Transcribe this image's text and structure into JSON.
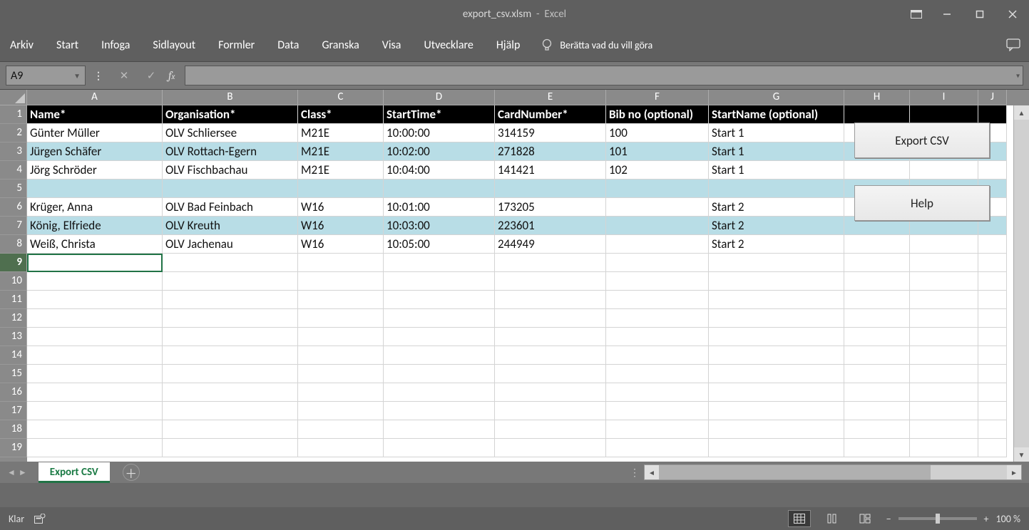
{
  "title": {
    "filename": "export_csv.xlsm",
    "app": "Excel"
  },
  "ribbon": {
    "tabs": [
      "Arkiv",
      "Start",
      "Infoga",
      "Sidlayout",
      "Formler",
      "Data",
      "Granska",
      "Visa",
      "Utvecklare",
      "Hjälp"
    ],
    "tell_me": "Berätta vad du vill göra"
  },
  "formula_bar": {
    "name_box": "A9",
    "formula": ""
  },
  "columns": [
    {
      "letter": "A",
      "width": 190
    },
    {
      "letter": "B",
      "width": 190
    },
    {
      "letter": "C",
      "width": 120
    },
    {
      "letter": "D",
      "width": 156
    },
    {
      "letter": "E",
      "width": 156
    },
    {
      "letter": "F",
      "width": 144
    },
    {
      "letter": "G",
      "width": 190
    },
    {
      "letter": "H",
      "width": 92
    },
    {
      "letter": "I",
      "width": 96
    },
    {
      "letter": "J",
      "width": 40
    }
  ],
  "headers": [
    "Name*",
    "Organisation*",
    "Class*",
    "StartTime*",
    "CardNumber*",
    "Bib no (optional)",
    "StartName (optional)"
  ],
  "rows": [
    {
      "alt": false,
      "cells": [
        "Günter Müller",
        "OLV Schliersee",
        "M21E",
        "10:00:00",
        "314159",
        "100",
        "Start 1"
      ]
    },
    {
      "alt": true,
      "cells": [
        "Jürgen Schäfer",
        "OLV Rottach-Egern",
        "M21E",
        "10:02:00",
        "271828",
        "101",
        "Start 1"
      ]
    },
    {
      "alt": false,
      "cells": [
        "Jörg Schröder",
        "OLV Fischbachau",
        "M21E",
        "10:04:00",
        "141421",
        "102",
        "Start 1"
      ]
    },
    {
      "alt": true,
      "cells": [
        "",
        "",
        "",
        "",
        "",
        "",
        ""
      ]
    },
    {
      "alt": false,
      "cells": [
        "Krüger, Anna",
        "OLV Bad Feinbach",
        "W16",
        "10:01:00",
        "173205",
        "",
        "Start 2"
      ]
    },
    {
      "alt": true,
      "cells": [
        "König, Elfriede",
        "OLV Kreuth",
        "W16",
        "10:03:00",
        "223601",
        "",
        "Start 2"
      ]
    },
    {
      "alt": false,
      "cells": [
        "Weiß, Christa",
        "OLV Jachenau",
        "W16",
        "10:05:00",
        "244949",
        "",
        "Start 2"
      ]
    }
  ],
  "total_rows": 19,
  "selected_row": 9,
  "buttons": {
    "export": "Export CSV",
    "help": "Help"
  },
  "sheet_tab": "Export CSV",
  "status": {
    "ready": "Klar",
    "zoom": "100 %"
  }
}
